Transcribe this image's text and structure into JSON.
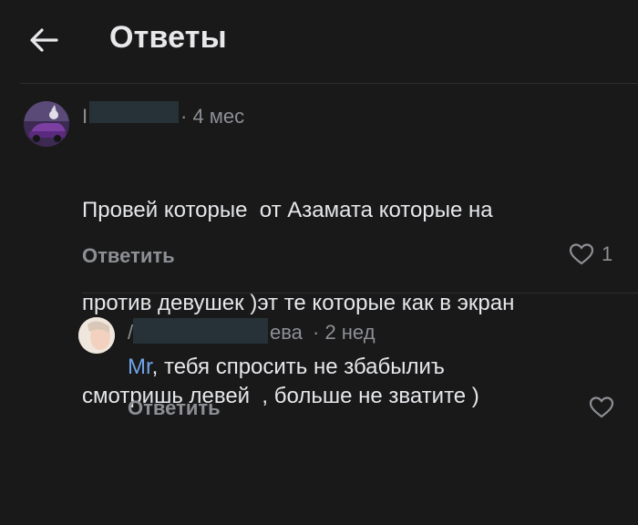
{
  "header": {
    "title": "Ответы"
  },
  "comment": {
    "author_initial": "I",
    "time": "· 4 мес",
    "lines": [
      "Провей которые  от Азамата которые на",
      "против девушек )эт те которые как в экран",
      "смотришь левей  , больше не зватите )"
    ],
    "reply_label": "Ответить",
    "likes": "1"
  },
  "reply": {
    "author_initial": "/",
    "author_suffix": "ева",
    "time": "· 2 нед",
    "mention": "Mr",
    "text": ", тебя спросить не збабылиъ",
    "reply_label": "Ответить"
  },
  "colors": {
    "background": "#19191a",
    "mention": "#6fa3e6",
    "muted": "#8d8f94",
    "redaction": "#263238"
  }
}
